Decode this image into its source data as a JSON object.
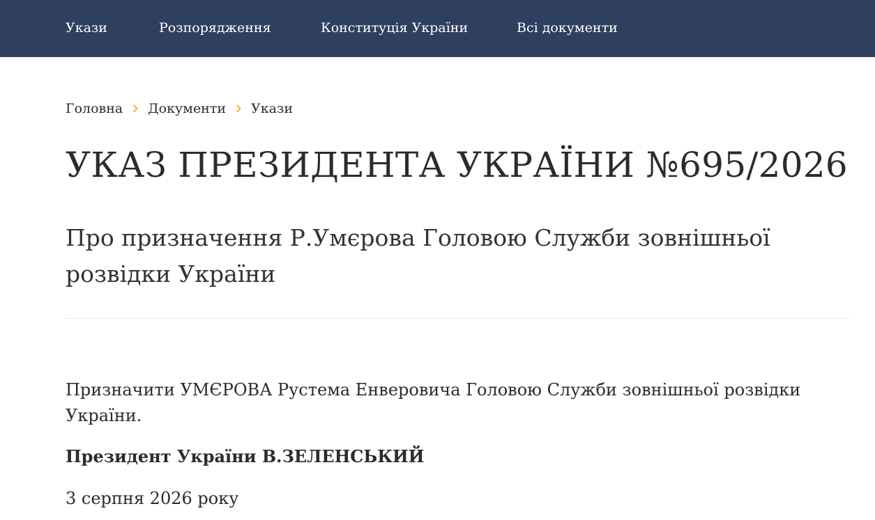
{
  "nav": {
    "items": [
      {
        "label": "Укази"
      },
      {
        "label": "Розпорядження"
      },
      {
        "label": "Конституція України"
      },
      {
        "label": "Всі документи"
      }
    ],
    "background_color": "#2e3f5f"
  },
  "breadcrumb": {
    "items": [
      {
        "label": "Головна"
      },
      {
        "label": "Документи"
      },
      {
        "label": "Укази"
      }
    ],
    "separator_icon": "chevron-right-icon",
    "separator_color": "#e8b21a"
  },
  "document": {
    "title": "УКАЗ ПРЕЗИДЕНТА УКРАЇНИ №695/2026",
    "subtitle": "Про призначення Р.Умєрова Головою Служби зовнішньої розвідки України",
    "body": "Призначити УМЄРОВА Рустема Енверовича Головою Служби зовнішньої розвідки України.",
    "signature": "Президент України В.ЗЕЛЕНСЬКИЙ",
    "date": "3 серпня 2026 року"
  }
}
